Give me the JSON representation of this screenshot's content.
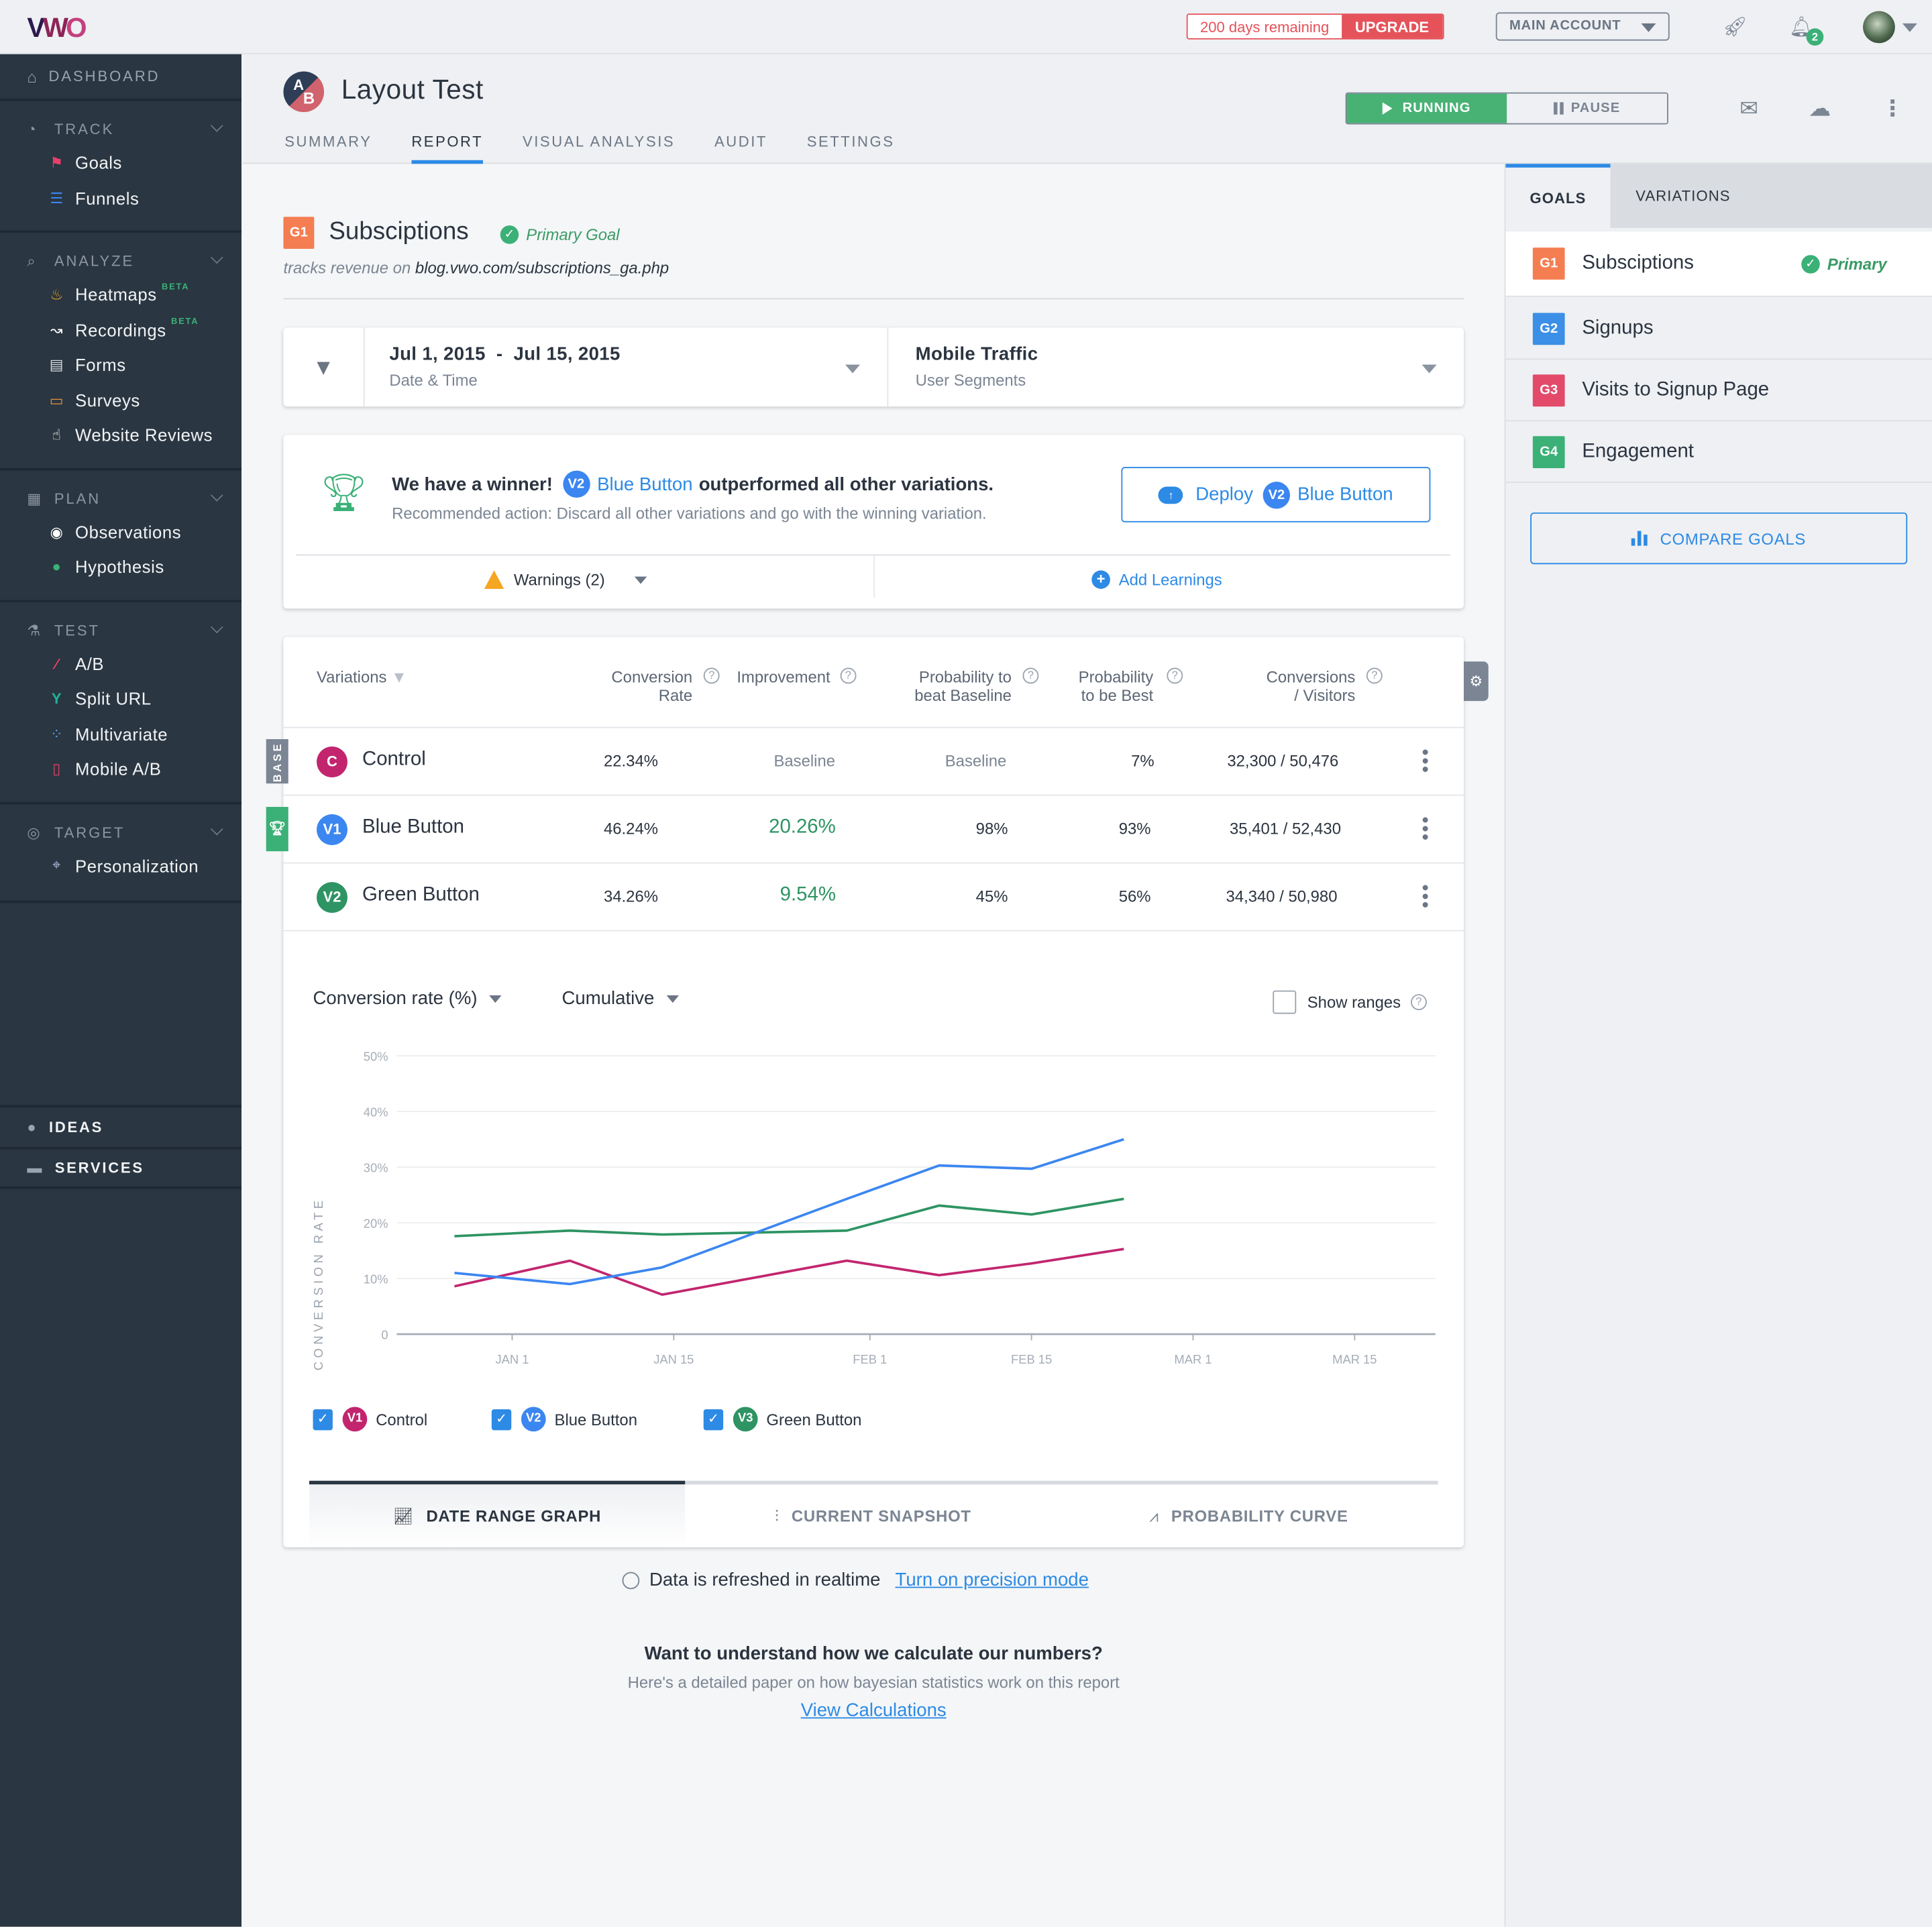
{
  "topbar": {
    "logo": {
      "v": "V",
      "w": "W",
      "o": "O"
    },
    "trial": {
      "days_remaining": "200 days remaining",
      "upgrade_label": "UPGRADE"
    },
    "account": {
      "label": "MAIN ACCOUNT"
    },
    "notifications": {
      "count": "2"
    },
    "colors": {
      "upgrade": "#e5525a",
      "badge": "#3bb077"
    }
  },
  "sidebar": {
    "dashboard": "DASHBOARD",
    "sections": [
      {
        "title": "TRACK",
        "items": [
          {
            "label": "Goals"
          },
          {
            "label": "Funnels"
          }
        ]
      },
      {
        "title": "ANALYZE",
        "items": [
          {
            "label": "Heatmaps",
            "badge": "BETA"
          },
          {
            "label": "Recordings",
            "badge": "BETA"
          },
          {
            "label": "Forms"
          },
          {
            "label": "Surveys"
          },
          {
            "label": "Website Reviews"
          }
        ]
      },
      {
        "title": "PLAN",
        "items": [
          {
            "label": "Observations"
          },
          {
            "label": "Hypothesis"
          }
        ]
      },
      {
        "title": "TEST",
        "items": [
          {
            "label": "A/B"
          },
          {
            "label": "Split URL"
          },
          {
            "label": "Multivariate"
          },
          {
            "label": "Mobile A/B"
          }
        ]
      },
      {
        "title": "TARGET",
        "items": [
          {
            "label": "Personalization"
          }
        ]
      }
    ],
    "bottom": [
      {
        "label": "IDEAS"
      },
      {
        "label": "SERVICES"
      }
    ]
  },
  "header": {
    "avatar": {
      "a": "A",
      "b": "B"
    },
    "title": "Layout Test",
    "tabs": [
      {
        "label": "SUMMARY"
      },
      {
        "label": "REPORT",
        "active": true
      },
      {
        "label": "VISUAL ANALYSIS"
      },
      {
        "label": "AUDIT"
      },
      {
        "label": "SETTINGS"
      }
    ],
    "status": {
      "running": "RUNNING",
      "pause": "PAUSE"
    }
  },
  "goal": {
    "badge": "G1",
    "title": "Subsciptions",
    "primary_label": "Primary Goal",
    "tracks_prefix": "tracks revenue on",
    "tracks_url": "blog.vwo.com/subscriptions_ga.php"
  },
  "filters": {
    "date": {
      "value_start": "Jul 1, 2015",
      "sep": "-",
      "value_end": "Jul 15, 2015",
      "label": "Date & Time"
    },
    "segment": {
      "value": "Mobile Traffic",
      "label": "User Segments"
    }
  },
  "winner": {
    "lead": "We have a winner!",
    "variation_badge": "V2",
    "variation_name": "Blue Button",
    "tail": "outperformed all other variations.",
    "recommendation": "Recommended action: Discard all other variations and go with the winning variation.",
    "deploy_label": "Deploy",
    "warnings_label": "Warnings (2)",
    "add_learnings_label": "Add Learnings"
  },
  "table": {
    "headers": {
      "variations": "Variations",
      "conv_rate_1": "Conversion",
      "conv_rate_2": "Rate",
      "improvement": "Improvement",
      "prob_beat_1": "Probability to",
      "prob_beat_2": "beat Baseline",
      "prob_best_1": "Probability",
      "prob_best_2": "to be Best",
      "conv_vis_1": "Conversions",
      "conv_vis_2": "/ Visitors"
    },
    "base_tag": "BASE",
    "rows": [
      {
        "badge": "C",
        "name": "Control",
        "color": "#c2256e",
        "conversion_rate": "22.34%",
        "improvement": "Baseline",
        "prob_beat": "Baseline",
        "prob_best": "7%",
        "conv_visitors": "32,300 / 50,476"
      },
      {
        "badge": "V1",
        "name": "Blue Button",
        "color": "#3b86f0",
        "conversion_rate": "46.24%",
        "improvement": "20.26%",
        "prob_beat": "98%",
        "prob_best": "93%",
        "conv_visitors": "35,401 / 52,430"
      },
      {
        "badge": "V2",
        "name": "Green Button",
        "color": "#2e9463",
        "conversion_rate": "34.26%",
        "improvement": "9.54%",
        "prob_beat": "45%",
        "prob_best": "56%",
        "conv_visitors": "34,340 / 50,980"
      }
    ]
  },
  "chart_controls": {
    "metric": "Conversion rate (%)",
    "mode": "Cumulative",
    "show_ranges_label": "Show ranges",
    "show_ranges_checked": false
  },
  "chart_data": {
    "type": "line",
    "title": "",
    "xlabel": "",
    "ylabel": "CONVERSION RATE",
    "ylim": [
      0,
      50
    ],
    "yticks": [
      "0",
      "10%",
      "20%",
      "30%",
      "40%",
      "50%"
    ],
    "x_tick_labels": [
      "JAN 1",
      "JAN 15",
      "FEB 1",
      "FEB 15",
      "MAR 1",
      "MAR 15"
    ],
    "x_days": [
      -5,
      5,
      13,
      29,
      37,
      45,
      53
    ],
    "x_tick_days": [
      0,
      14,
      31,
      45,
      59,
      73
    ],
    "grid": true,
    "series": [
      {
        "name": "Control",
        "badge": "V1",
        "color": "#c2256e",
        "values": [
          8.6,
          13.2,
          7.1,
          13.2,
          10.6,
          12.7,
          15.3
        ]
      },
      {
        "name": "Blue Button",
        "badge": "V2",
        "color": "#3b86f0",
        "values": [
          11.0,
          9.0,
          12.0,
          24.3,
          30.3,
          29.7,
          35.0
        ]
      },
      {
        "name": "Green Button",
        "badge": "V3",
        "color": "#2e9463",
        "values": [
          17.6,
          18.6,
          17.9,
          18.6,
          23.1,
          21.5,
          24.3
        ]
      }
    ],
    "legend": "bottom-left"
  },
  "graph_tabs": [
    {
      "label": "DATE RANGE GRAPH",
      "active": true
    },
    {
      "label": "CURRENT SNAPSHOT"
    },
    {
      "label": "PROBABILITY CURVE"
    }
  ],
  "footer": {
    "refresh_text": "Data is refreshed in realtime",
    "precision_link": "Turn on precision mode",
    "calc_title": "Want to understand how we calculate our numbers?",
    "calc_sub": "Here's a detailed paper on how bayesian statistics work on this report",
    "calc_link": "View Calculations"
  },
  "right_panel": {
    "tabs": [
      {
        "label": "GOALS",
        "active": true
      },
      {
        "label": "VARIATIONS"
      }
    ],
    "goals": [
      {
        "badge": "G1",
        "name": "Subsciptions",
        "color": "#f47e52",
        "primary": "Primary"
      },
      {
        "badge": "G2",
        "name": "Signups",
        "color": "#3b8fe6"
      },
      {
        "badge": "G3",
        "name": "Visits to Signup Page",
        "color": "#e34a6a"
      },
      {
        "badge": "G4",
        "name": "Engagement",
        "color": "#3bb077"
      }
    ],
    "compare_label": "COMPARE GOALS"
  }
}
